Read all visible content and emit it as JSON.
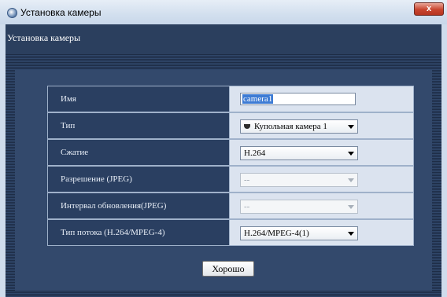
{
  "window": {
    "title": "Установка камеры",
    "close_label": "x",
    "icon": "camera-app-icon"
  },
  "header": {
    "title": "Установка камеры"
  },
  "form": {
    "name": {
      "label": "Имя",
      "value": "camera1"
    },
    "type": {
      "label": "Тип",
      "value": "Купольная камера 1",
      "icon": "dome-camera-icon"
    },
    "compression": {
      "label": "Сжатие",
      "value": "H.264"
    },
    "resolution": {
      "label": "Разрешение (JPEG)",
      "value": "--",
      "disabled": true
    },
    "refresh_interval": {
      "label": "Интервал обновления(JPEG)",
      "value": "--",
      "disabled": true
    },
    "stream_type": {
      "label": "Тип потока (H.264/MPEG-4)",
      "value": "H.264/MPEG-4(1)"
    }
  },
  "buttons": {
    "ok_label": "Хорошо"
  }
}
